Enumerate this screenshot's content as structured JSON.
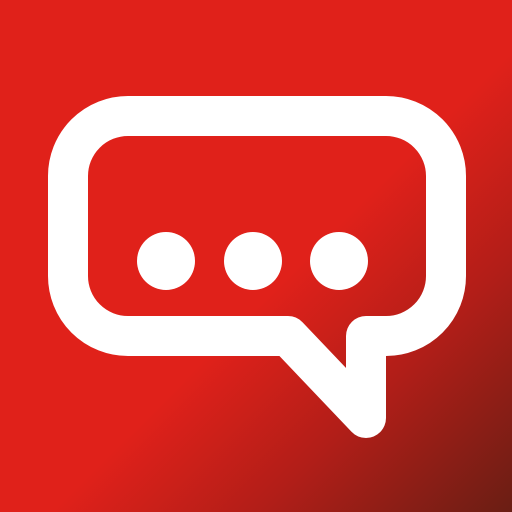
{
  "icon": {
    "name": "chat-bubble-ellipsis-icon",
    "colors": {
      "gradient_primary": "#E0211A",
      "gradient_mid": "#C61F1B",
      "gradient_dark": "#6A1E14",
      "bubble_stroke": "#FFFFFF",
      "dots": "#FFFFFF"
    }
  }
}
